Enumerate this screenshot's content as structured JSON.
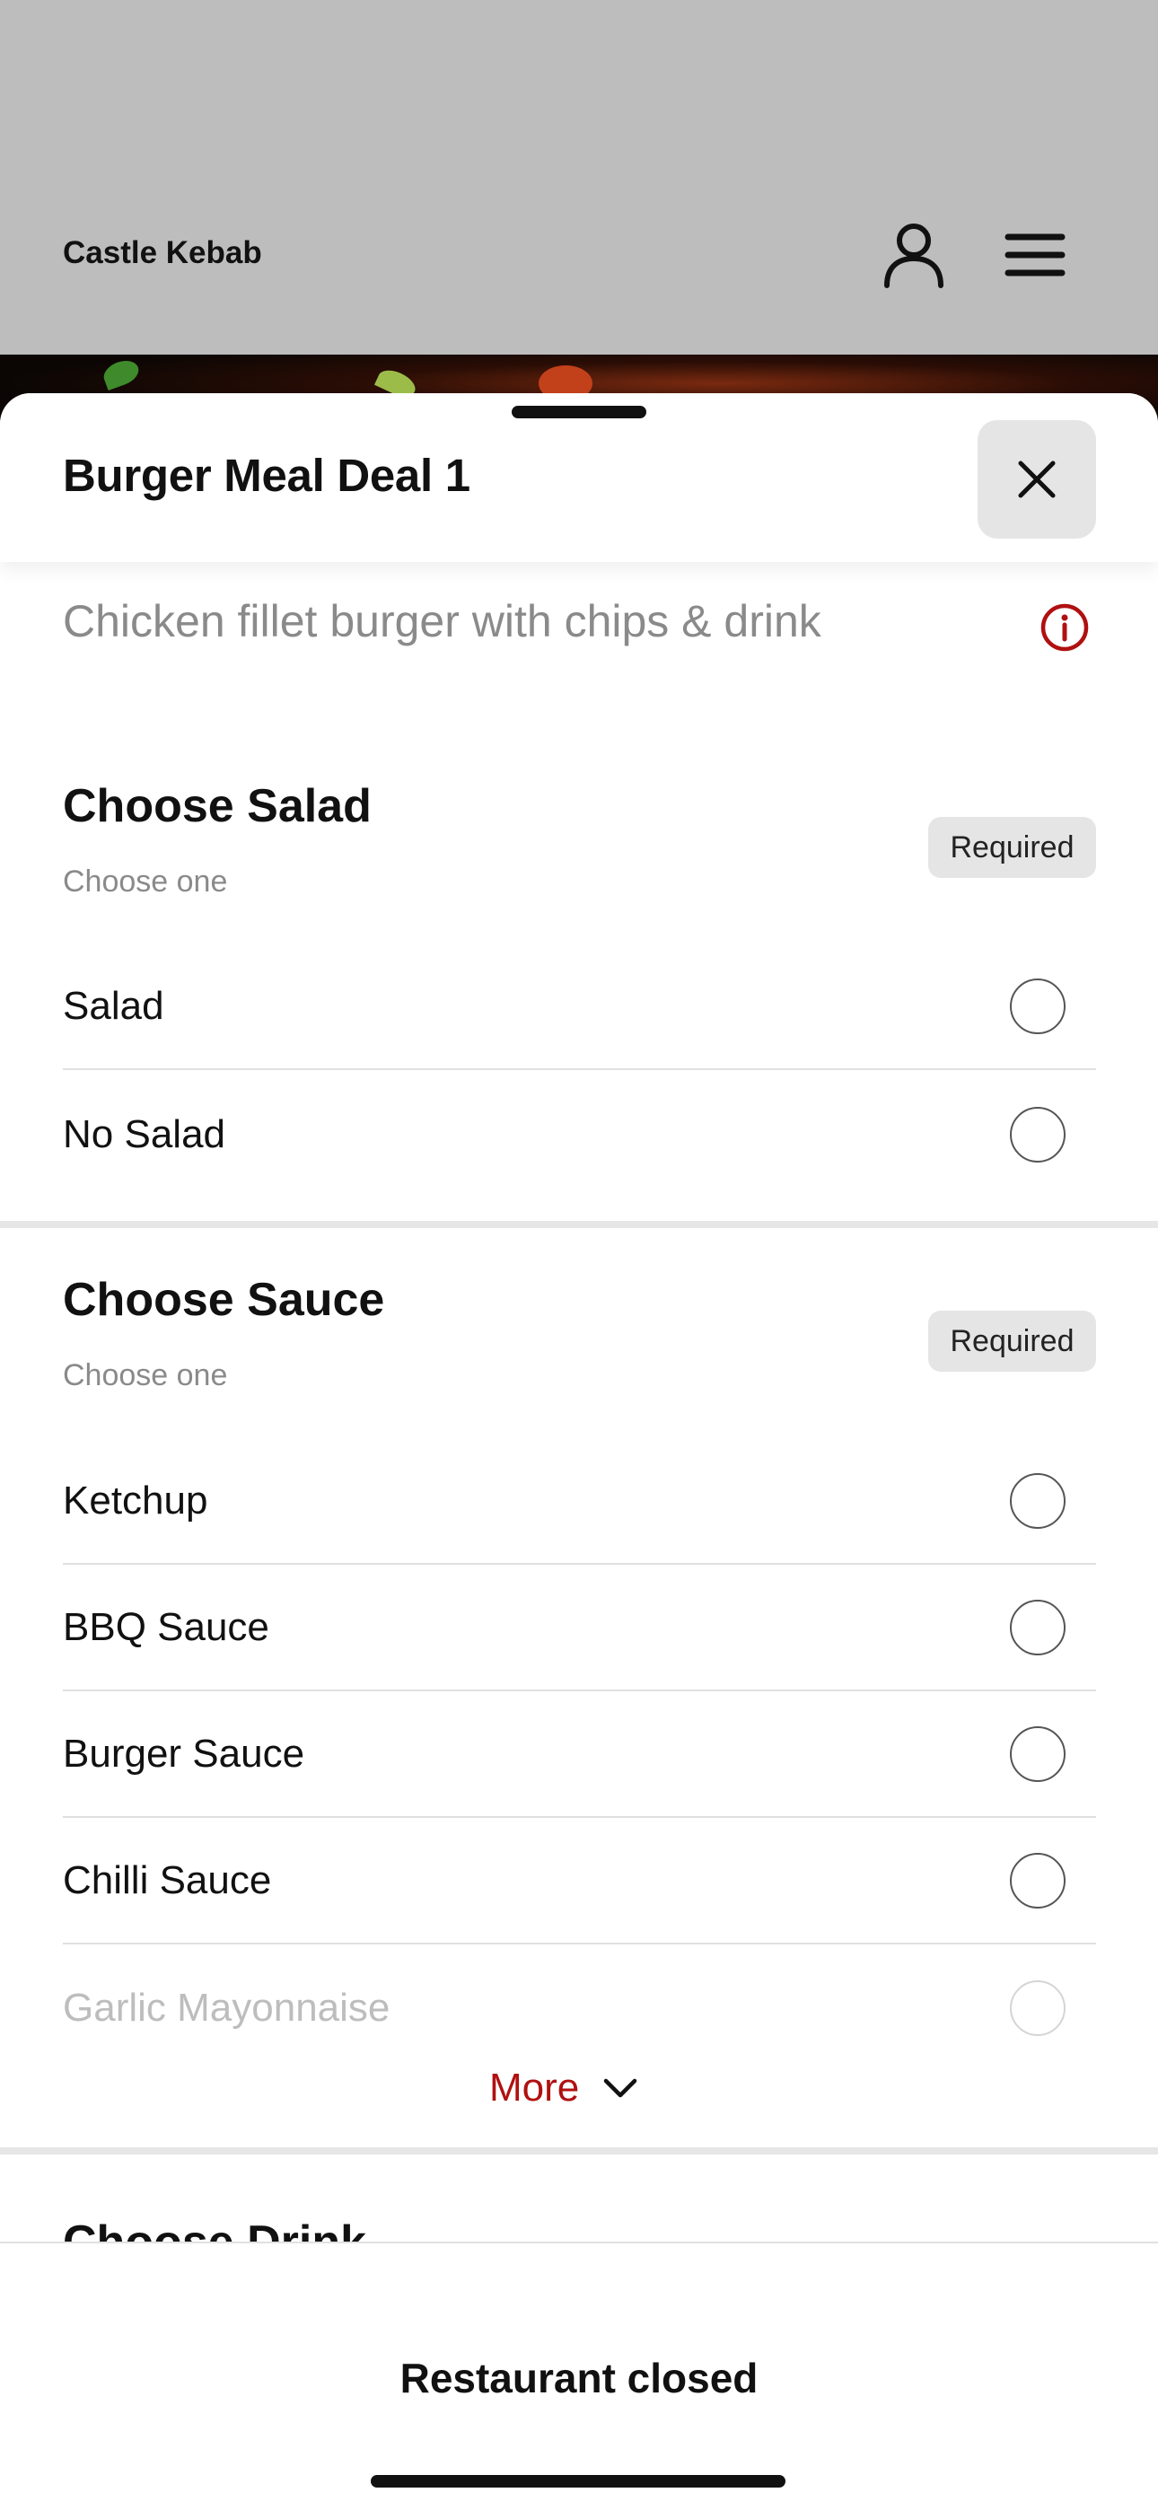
{
  "header": {
    "brand": "Castle Kebab",
    "account_icon": "user-icon",
    "menu_icon": "hamburger-menu-icon"
  },
  "sheet": {
    "title": "Burger Meal Deal 1",
    "close_icon": "close-icon",
    "description": "Chicken fillet burger with chips & drink",
    "info_icon": "info-icon",
    "accent_color": "#b01010"
  },
  "groups": [
    {
      "title": "Choose Salad",
      "subtitle": "Choose one",
      "badge": "Required",
      "options": [
        "Salad",
        "No Salad"
      ]
    },
    {
      "title": "Choose Sauce",
      "subtitle": "Choose one",
      "badge": "Required",
      "options": [
        "Ketchup",
        "BBQ Sauce",
        "Burger Sauce",
        "Chilli Sauce",
        "Garlic Mayonnaise"
      ],
      "more_label": "More"
    },
    {
      "title": "Choose Drink"
    }
  ],
  "footer": {
    "status": "Restaurant closed"
  }
}
